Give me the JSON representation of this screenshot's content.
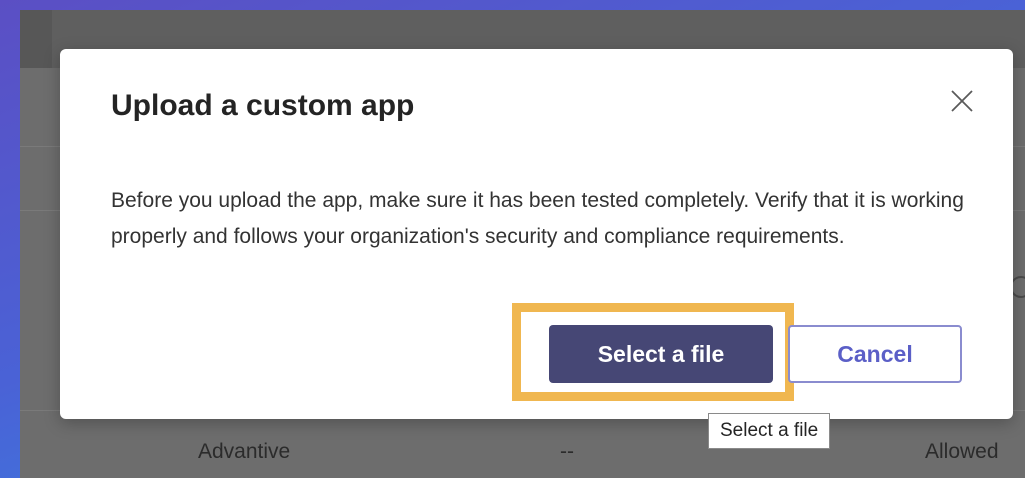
{
  "dialog": {
    "title": "Upload a custom app",
    "body": "Before you upload the app, make sure it has been tested completely. Verify that it is working properly and follows your organization's security and compliance requirements.",
    "primary_button_label": "Select a file",
    "secondary_button_label": "Cancel",
    "close_icon": "close-icon"
  },
  "tooltip": {
    "text": "Select a file"
  },
  "background_row": {
    "app_name": "Advantive",
    "middle_value": "--",
    "status": "Allowed"
  },
  "colors": {
    "primary_button": "#464775",
    "secondary_button_text": "#5b5fc7",
    "highlight_frame": "#f0b750"
  }
}
